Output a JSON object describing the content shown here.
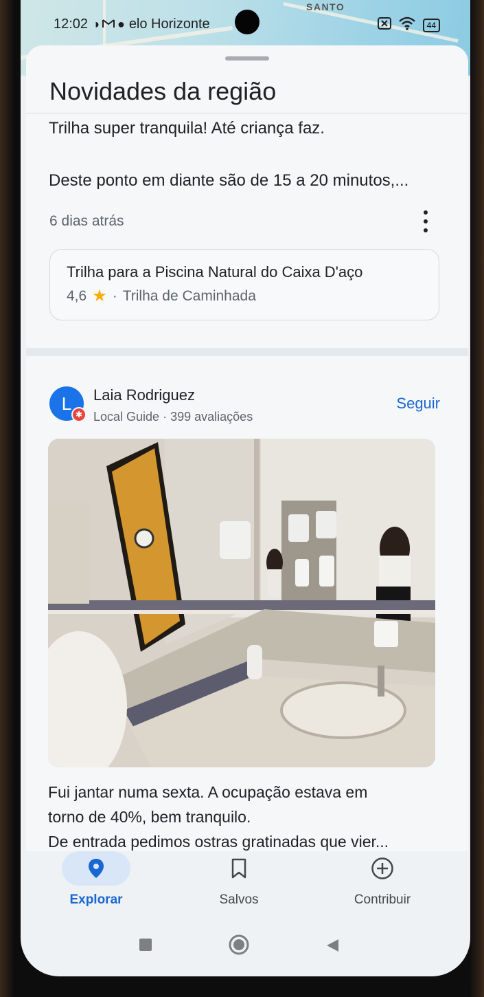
{
  "status_bar": {
    "time": "12:02",
    "left_icons": [
      "data-saver-icon",
      "gmail-icon",
      "notification-icon"
    ],
    "location_text": "elo Horizonte",
    "map_label": "SANTO",
    "battery": "44"
  },
  "sheet": {
    "title": "Novidades da região"
  },
  "review_1": {
    "line_1": "Trilha super tranquila! Até criança faz.",
    "line_2": "Deste ponto em diante são de 15 a 20 minutos,...",
    "time_ago": "6 dias atrás"
  },
  "place_card": {
    "name": "Trilha para a Piscina Natural do Caixa D'aço",
    "rating": "4,6",
    "separator": "·",
    "category": "Trilha de Caminhada"
  },
  "author": {
    "initial": "L",
    "name": "Laia Rodriguez",
    "level": "Local Guide",
    "separator": "·",
    "reviews": "399 avaliações",
    "follow_label": "Seguir"
  },
  "review_2": {
    "line_1": "Fui jantar numa sexta. A ocupação estava em",
    "line_2": "torno de 40%, bem tranquilo.",
    "line_3": "De entrada pedimos ostras gratinadas que vier..."
  },
  "bottom_nav": {
    "items": [
      {
        "label": "Explorar",
        "icon": "location-pin-icon",
        "active": true
      },
      {
        "label": "Salvos",
        "icon": "bookmark-icon",
        "active": false
      },
      {
        "label": "Contribuir",
        "icon": "add-circle-icon",
        "active": false
      }
    ]
  },
  "colors": {
    "accent": "#1967d2",
    "star": "#f9ab00",
    "avatar": "#1a73e8",
    "badge": "#e8453c"
  }
}
